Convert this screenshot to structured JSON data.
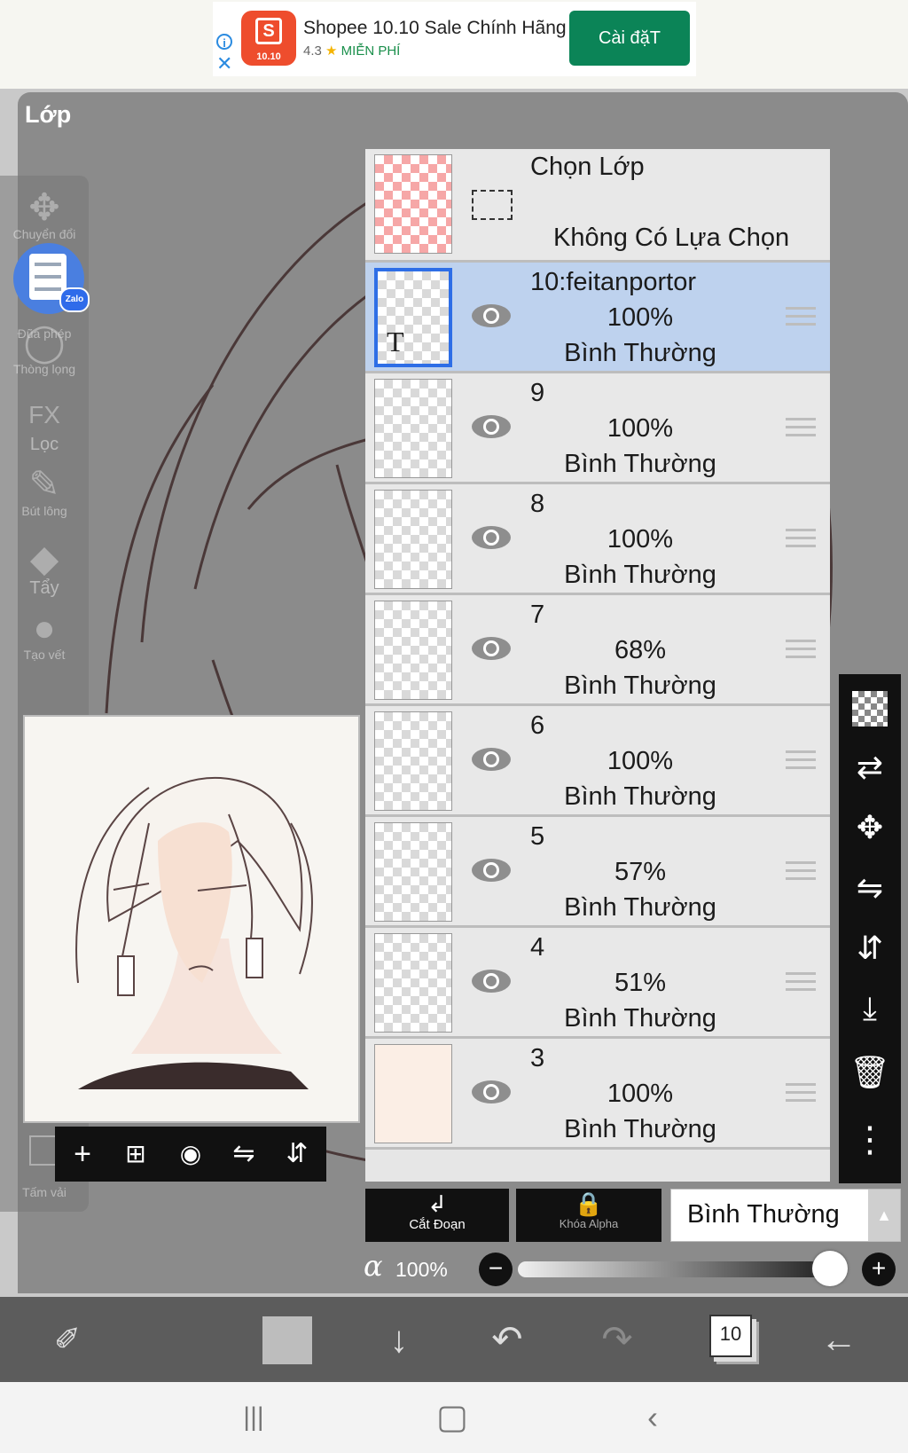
{
  "ad": {
    "title": "Shopee 10.10 Sale Chính Hãng",
    "rating": "4.3",
    "price": "MIỄN PHÍ",
    "cta": "Cài đặT",
    "logo_text": "10.10",
    "logo_letter": "S",
    "brand_color": "#ee4d2d",
    "cta_color": "#0b8457"
  },
  "panel": {
    "title": "Lớp"
  },
  "tool_rail": {
    "items": [
      {
        "label": "Chuyển đổi",
        "icon": "move-icon"
      },
      {
        "label": "Đũa phép",
        "icon": "magic-wand-icon"
      },
      {
        "label": "Thòng lọng",
        "icon": "lasso-icon"
      },
      {
        "label": "Lọc",
        "icon": "fx-icon"
      },
      {
        "label": "Bút lông",
        "icon": "brush-icon"
      },
      {
        "label": "Tẩy",
        "icon": "eraser-icon"
      },
      {
        "label": "Tạo vết",
        "icon": "smudge-icon"
      },
      {
        "label": "Tấm vải",
        "icon": "canvas-icon"
      }
    ],
    "zalo_badge": "Zalo"
  },
  "selection_layer": {
    "title": "Chọn Lớp",
    "status": "Không Có Lựa Chọn"
  },
  "layers": [
    {
      "name": "10:feitanportor",
      "opacity": "100%",
      "blend": "Bình Thường",
      "selected": true,
      "thumb_letter": "T"
    },
    {
      "name": "9",
      "opacity": "100%",
      "blend": "Bình Thường"
    },
    {
      "name": "8",
      "opacity": "100%",
      "blend": "Bình Thường"
    },
    {
      "name": "7",
      "opacity": "68%",
      "blend": "Bình Thường"
    },
    {
      "name": "6",
      "opacity": "100%",
      "blend": "Bình Thường"
    },
    {
      "name": "5",
      "opacity": "57%",
      "blend": "Bình Thường"
    },
    {
      "name": "4",
      "opacity": "51%",
      "blend": "Bình Thường"
    },
    {
      "name": "3",
      "opacity": "100%",
      "blend": "Bình Thường"
    }
  ],
  "layer_controls": {
    "clip_label": "Cắt Đoạn",
    "alpha_lock_label": "Khóa Alpha",
    "blend_mode": "Bình Thường",
    "alpha_symbol": "α",
    "alpha_value": "100%",
    "opacity_fraction": 1.0,
    "minus": "−",
    "plus": "+"
  },
  "bottom_bar": {
    "layer_count": "10",
    "current_color": "#bdbdbd"
  },
  "colors": {
    "selected_row": "#bed2ee",
    "selected_border": "#2e6ee6",
    "panel_gray": "#8b8b8b"
  }
}
